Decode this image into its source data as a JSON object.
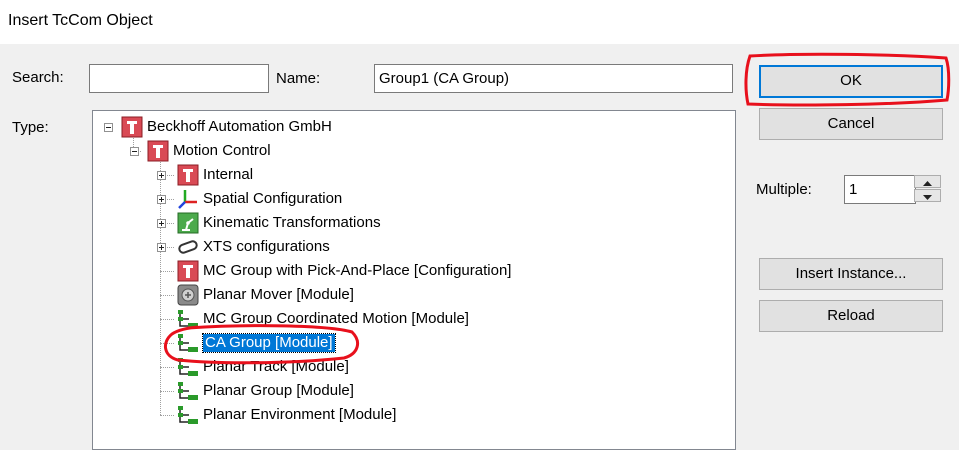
{
  "window": {
    "title": "Insert TcCom Object"
  },
  "search": {
    "label": "Search:",
    "value": ""
  },
  "name": {
    "label": "Name:",
    "value": "Group1 (CA Group)"
  },
  "type": {
    "label": "Type:"
  },
  "buttons": {
    "ok": "OK",
    "cancel": "Cancel",
    "insert_instance": "Insert Instance...",
    "reload": "Reload"
  },
  "multiple": {
    "label": "Multiple:",
    "value": "1"
  },
  "tree": {
    "nodes": [
      {
        "label": "Beckhoff Automation GmbH",
        "icon": "tc-red-icon",
        "expander": "minus"
      },
      {
        "label": "Motion Control",
        "icon": "tc-red-icon",
        "expander": "minus"
      },
      {
        "label": "Internal",
        "icon": "tc-red-icon",
        "expander": "plus"
      },
      {
        "label": "Spatial Configuration",
        "icon": "axes-icon",
        "expander": "plus"
      },
      {
        "label": "Kinematic Transformations",
        "icon": "robot-arm-icon",
        "expander": "plus"
      },
      {
        "label": "XTS configurations",
        "icon": "xts-track-icon",
        "expander": "plus"
      },
      {
        "label": "MC Group with Pick-And-Place [Configuration]",
        "icon": "tc-red-icon",
        "expander": ""
      },
      {
        "label": "Planar Mover [Module]",
        "icon": "planar-mover-icon",
        "expander": ""
      },
      {
        "label": "MC Group Coordinated Motion [Module]",
        "icon": "module-icon",
        "expander": ""
      },
      {
        "label": "CA Group [Module]",
        "icon": "module-icon",
        "expander": "",
        "selected": true
      },
      {
        "label": "Planar Track [Module]",
        "icon": "module-icon",
        "expander": ""
      },
      {
        "label": "Planar Group [Module]",
        "icon": "module-icon",
        "expander": ""
      },
      {
        "label": "Planar Environment [Module]",
        "icon": "module-icon",
        "expander": ""
      }
    ]
  },
  "colors": {
    "selection": "#0078d7",
    "annotation": "#e8101c",
    "tc_red": "#d94a55",
    "module_green": "#2a9a2a"
  }
}
